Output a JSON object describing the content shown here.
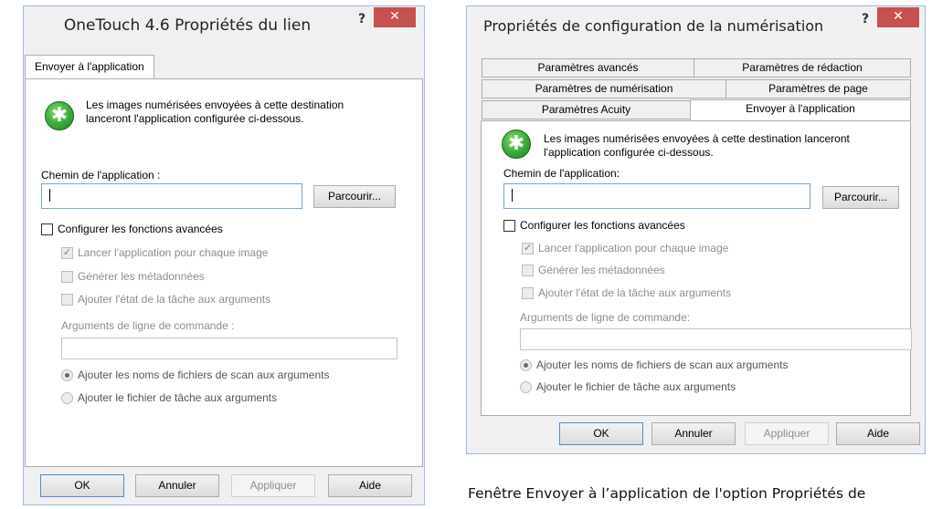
{
  "left_dialog": {
    "title": "OneTouch 4.6 Propriétés du lien",
    "help_glyph": "?",
    "close_glyph": "✕",
    "tab_label": "Envoyer à l'application",
    "info_text_line1": "Les images numérisées envoyées à cette destination",
    "info_text_line2": "lanceront l'application configurée ci-dessous.",
    "app_path_label": "Chemin de l'application :",
    "app_path_value": "",
    "browse_button": "Parcourir...",
    "advanced_checkbox": "Configurer les fonctions avancées",
    "launch_each_image": "Lancer l'application pour chaque image",
    "generate_metadata": "Générer les métadonnées",
    "add_job_state": "Ajouter l'état de la tâche aux arguments",
    "cmd_args_label": "Arguments de ligne de commande :",
    "cmd_args_value": "",
    "radio_add_scan_filenames": "Ajouter les noms de fichiers de scan aux arguments",
    "radio_add_job_file": "Ajouter le fichier de tâche aux arguments",
    "ok_button": "OK",
    "cancel_button": "Annuler",
    "apply_button": "Appliquer",
    "help_button": "Aide"
  },
  "right_dialog": {
    "title": "Propriétés de configuration de la numérisation",
    "help_glyph": "?",
    "close_glyph": "✕",
    "tabs_row1": [
      "Paramètres avancés",
      "Paramètres de rédaction"
    ],
    "tabs_row2": [
      "Paramètres de numérisation",
      "Paramètres de page"
    ],
    "tabs_row3": [
      "Paramètres Acuity",
      "Envoyer à l'application"
    ],
    "active_tab": "Envoyer à l'application",
    "info_text_line1": "Les images numérisées envoyées à cette destination lanceront",
    "info_text_line2": "l'application configurée ci-dessous.",
    "app_path_label": "Chemin de l'application:",
    "app_path_value": "",
    "browse_button": "Parcourir...",
    "advanced_checkbox": "Configurer les fonctions avancées",
    "launch_each_image": "Lancer l'application pour chaque image",
    "generate_metadata": "Générer les métadonnées",
    "add_job_state": "Ajouter l'état de la tâche aux arguments",
    "cmd_args_label": "Arguments de ligne de commande:",
    "cmd_args_value": "",
    "radio_add_scan_filenames": "Ajouter les noms de fichiers de scan aux arguments",
    "radio_add_job_file": "Ajouter le fichier de tâche aux arguments",
    "ok_button": "OK",
    "cancel_button": "Annuler",
    "apply_button": "Appliquer",
    "help_button": "Aide"
  },
  "caption": "Fenêtre Envoyer à l’application de l'option Propriétés de",
  "colors": {
    "close_button": "#c75050",
    "info_icon": "#38a83a",
    "input_border": "#7aa4d4"
  }
}
